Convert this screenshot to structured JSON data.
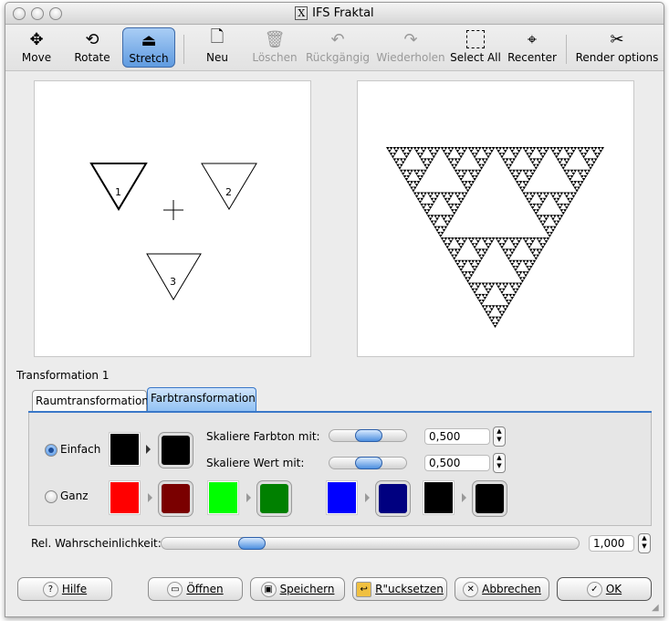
{
  "window": {
    "title": "IFS Fraktal"
  },
  "toolbar": [
    {
      "label": "Move",
      "icon": "move-icon",
      "state": "enabled"
    },
    {
      "label": "Rotate",
      "icon": "rotate-icon",
      "state": "enabled"
    },
    {
      "label": "Stretch",
      "icon": "stretch-icon",
      "state": "active"
    },
    {
      "label": "Neu",
      "icon": "new-document-icon",
      "state": "enabled"
    },
    {
      "label": "Löschen",
      "icon": "trash-icon",
      "state": "disabled"
    },
    {
      "label": "Rückgängig",
      "icon": "undo-icon",
      "state": "disabled"
    },
    {
      "label": "Wiederholen",
      "icon": "redo-icon",
      "state": "disabled"
    },
    {
      "label": "Select All",
      "icon": "select-all-icon",
      "state": "enabled"
    },
    {
      "label": "Recenter",
      "icon": "recenter-icon",
      "state": "enabled"
    },
    {
      "label": "Render options",
      "icon": "tools-icon",
      "state": "enabled"
    }
  ],
  "editor": {
    "transforms": [
      "1",
      "2",
      "3"
    ]
  },
  "preview": {
    "fractal": "sierpinski-triangle-inverted"
  },
  "section_label": "Transformation 1",
  "tabs": [
    {
      "label": "Raumtransformation",
      "selected": false
    },
    {
      "label": "Farbtransformation",
      "selected": true
    }
  ],
  "color": {
    "einfach_label": "Einfach",
    "einfach_selected": true,
    "ganz_label": "Ganz",
    "hue_label": "Skaliere Farbton mit:",
    "hue_value": "0,500",
    "hue_slider": 0.5,
    "value_label": "Skaliere Wert mit:",
    "value_value": "0,500",
    "value_slider": 0.5,
    "einfach_from": "#000000",
    "einfach_to": "#000000",
    "ganz_pairs": [
      [
        "#ff0000",
        "#7a0000"
      ],
      [
        "#00ff00",
        "#008000"
      ],
      [
        "#0000ff",
        "#000080"
      ],
      [
        "#000000",
        "#000000"
      ]
    ]
  },
  "probability": {
    "label": "Rel. Wahrscheinlichkeit:",
    "value": "1,000",
    "slider": 0.2
  },
  "buttons": {
    "help": "Hilfe",
    "open": "Öffnen",
    "save": "Speichern",
    "reset": "R\"ucksetzen",
    "cancel": "Abbrechen",
    "ok": "OK"
  }
}
